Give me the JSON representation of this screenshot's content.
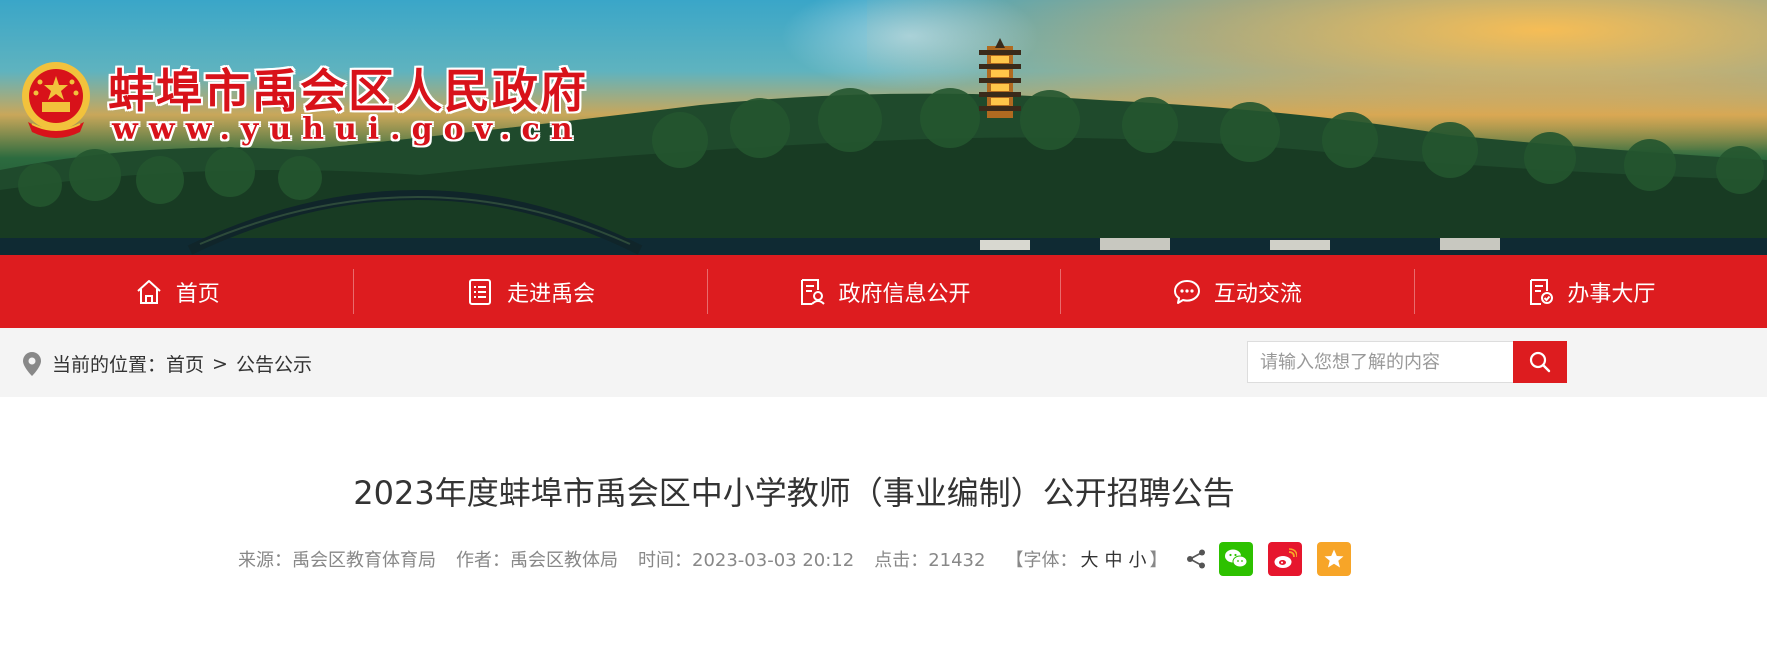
{
  "header": {
    "site_title": "蚌埠市禹会区人民政府",
    "site_url": "www.yuhui.gov.cn"
  },
  "nav": {
    "items": [
      {
        "label": "首页",
        "icon": "home-icon"
      },
      {
        "label": "走进禹会",
        "icon": "list-doc-icon"
      },
      {
        "label": "政府信息公开",
        "icon": "info-doc-icon"
      },
      {
        "label": "互动交流",
        "icon": "chat-icon"
      },
      {
        "label": "办事大厅",
        "icon": "service-doc-icon"
      }
    ]
  },
  "location": {
    "label": "当前的位置：",
    "crumbs": [
      "首页",
      "公告公示"
    ],
    "separator": ">"
  },
  "search": {
    "placeholder": "请输入您想了解的内容"
  },
  "article": {
    "title": "2023年度蚌埠市禹会区中小学教师（事业编制）公开招聘公告",
    "source": "来源：禹会区教育体育局",
    "author": "作者：禹会区教体局",
    "time": "时间：2023-03-03 20:12",
    "clicks": "点击：21432",
    "font_label_open": "【字体：",
    "font_large": "大",
    "font_medium": "中",
    "font_small": "小",
    "font_label_close": "】"
  },
  "colors": {
    "brand_red": "#dd1c1f",
    "wechat": "#2dc100",
    "weibo": "#e6162d",
    "favorite": "#f7a528"
  }
}
